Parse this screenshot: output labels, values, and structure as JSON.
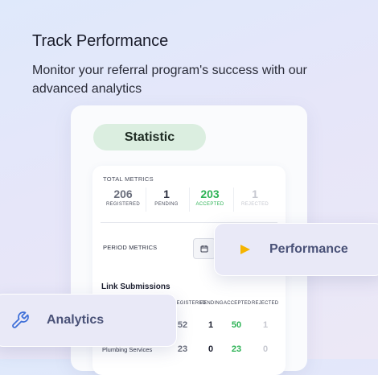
{
  "heading": "Track Performance",
  "subtitle": "Monitor your referral program's success with our advanced analytics",
  "card": {
    "pill": "Statistic",
    "total_metrics_label": "TOTAL METRICS",
    "metrics": [
      {
        "value": "206",
        "label": "REGISTERED",
        "color": "#6a6e7c"
      },
      {
        "value": "1",
        "label": "PENDING",
        "color": "#2c3040"
      },
      {
        "value": "203",
        "label": "ACCEPTED",
        "color": "#2eb356"
      },
      {
        "value": "1",
        "label": "REJECTED",
        "color": "#c6c8d0"
      }
    ],
    "period_metrics_label": "PERIOD METRICS",
    "calendar_icon": "calendar-icon",
    "link_submissions": {
      "title": "Link Submissions",
      "columns": [
        "REGISTERED",
        "PENDING",
        "ACCEPTED",
        "REJECTED"
      ],
      "rows": [
        {
          "label": "",
          "values": [
            "52",
            "1",
            "50",
            "1"
          ]
        },
        {
          "label": "Plumbing Services",
          "values": [
            "23",
            "0",
            "23",
            "0"
          ]
        }
      ]
    }
  },
  "floating": {
    "performance": {
      "label": "Performance",
      "icon": "play-icon",
      "icon_color": "#f5b400"
    },
    "analytics": {
      "label": "Analytics",
      "icon": "wrench-icon",
      "icon_color": "#3e6fd8"
    }
  }
}
